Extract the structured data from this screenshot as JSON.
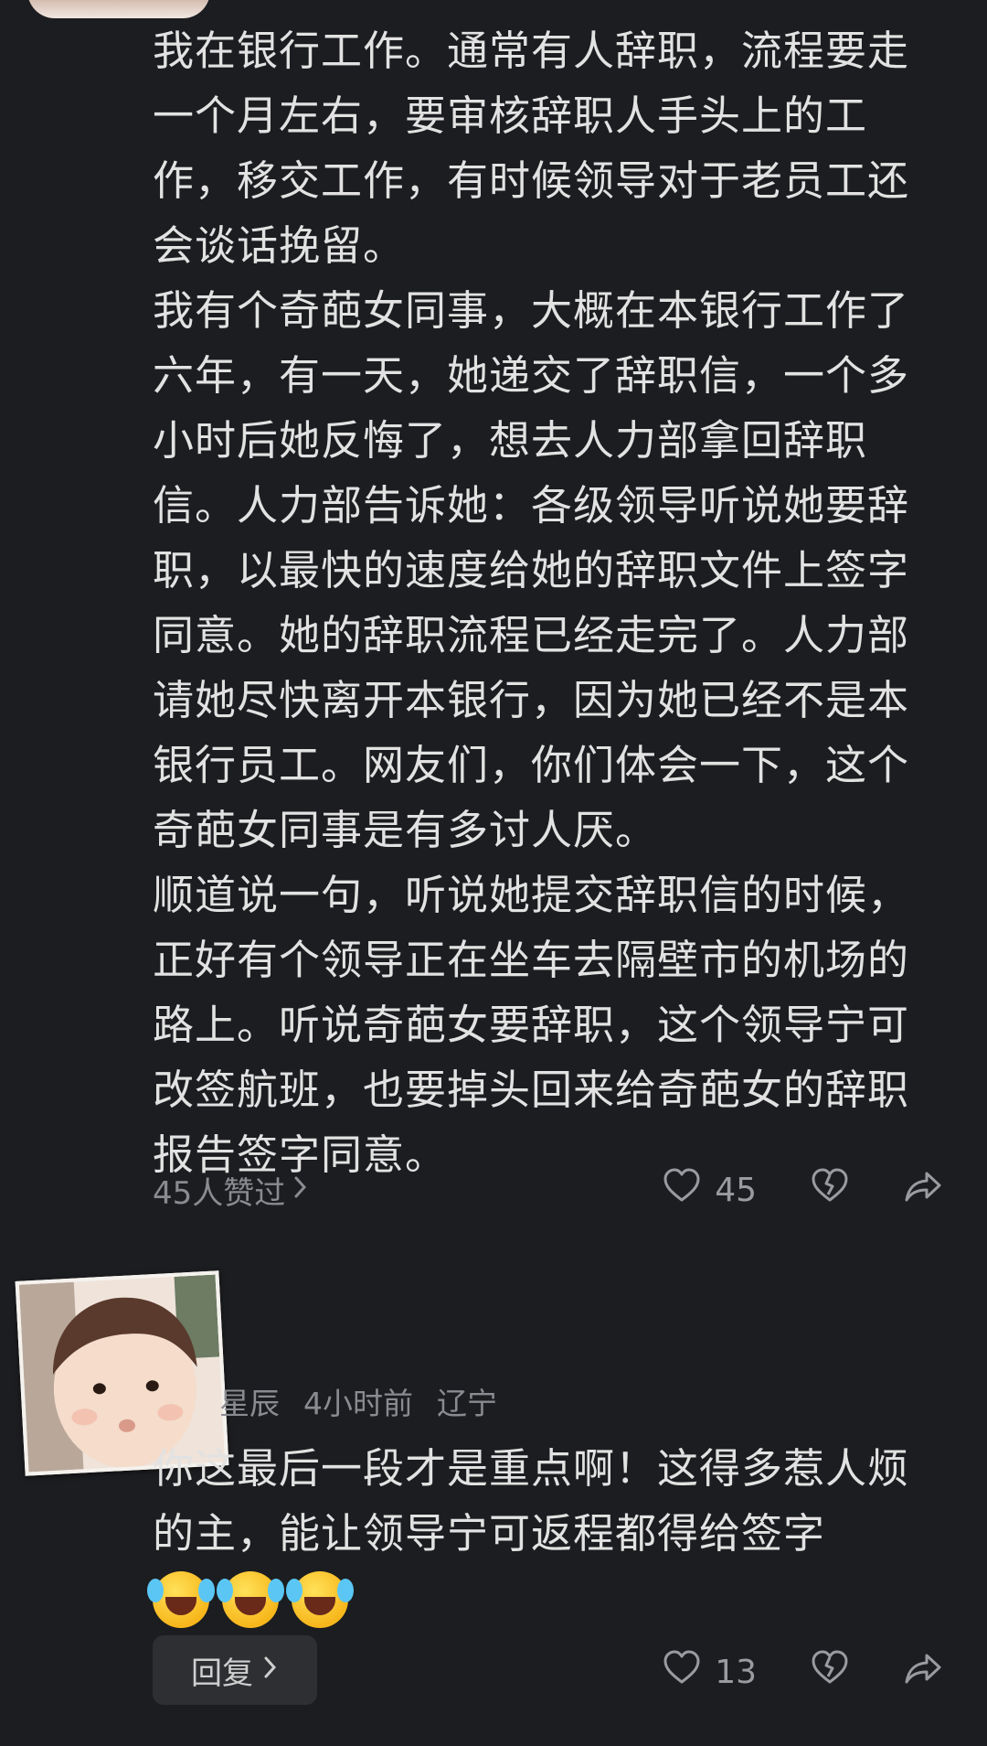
{
  "comment": {
    "paragraphs": [
      "我在银行工作。通常有人辞职，流程要走一个月左右，要审核辞职人手头上的工作，移交工作，有时候领导对于老员工还会谈话挽留。",
      "我有个奇葩女同事，大概在本银行工作了六年，有一天，她递交了辞职信，一个多小时后她反悔了，想去人力部拿回辞职信。人力部告诉她：各级领导听说她要辞职，以最快的速度给她的辞职文件上签字同意。她的辞职流程已经走完了。人力部请她尽快离开本银行，因为她已经不是本银行员工。网友们，你们体会一下，这个奇葩女同事是有多讨人厌。",
      "顺道说一句，听说她提交辞职信的时候，正好有个领导正在坐车去隔壁市的机场的路上。听说奇葩女要辞职，这个领导宁可改签航班，也要掉头回来给奇葩女的辞职报告签字同意。"
    ],
    "likes_link": "45人赞过",
    "like_count": "45"
  },
  "reply": {
    "username": "星辰",
    "time": "4小时前",
    "location": "辽宁",
    "text": "你这最后一段才是重点啊！这得多惹人烦的主，能让领导宁可返程都得给签字",
    "emojis": [
      "laugh-cry",
      "laugh-cry",
      "laugh-cry"
    ],
    "reply_label": "回复",
    "like_count": "13"
  },
  "icons": {
    "like": "heart-icon",
    "dislike": "broken-heart-icon",
    "share": "share-icon",
    "chevron": "chevron-right-icon"
  },
  "colors": {
    "background": "#1c1d20",
    "text": "#e2e2e2",
    "muted": "#8a8b90"
  }
}
